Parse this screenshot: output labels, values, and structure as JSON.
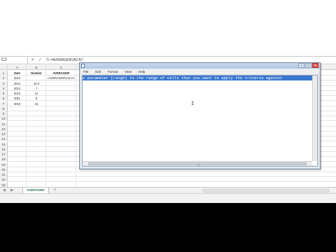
{
  "formula_bar": {
    "name_box": "C2",
    "icons": [
      "x-icon",
      "check-icon",
      "fx-icon"
    ],
    "cancel_symbol": "✕",
    "enter_symbol": "✓",
    "fx_symbol": "fx",
    "formula": "=AVERAGEIF(A2:A7,"
  },
  "sheet": {
    "columns": [
      "A",
      "B",
      "C"
    ],
    "headers": {
      "date": "Date",
      "number": "Number",
      "averageif": "AVERAGEIF"
    },
    "row_numbers": [
      "1",
      "2",
      "3",
      "4",
      "5",
      "6",
      "7",
      "8",
      "9",
      "10",
      "11",
      "12",
      "13",
      "14",
      "15",
      "16",
      "17",
      "18",
      "19",
      "20",
      "21",
      "22",
      "23"
    ],
    "rows": [
      {
        "a": "2012",
        "b": "",
        "c": "=AVERAGEIF(A2:A7,"
      },
      {
        "a": "2012",
        "b": "10.4",
        "c": ""
      },
      {
        "a": "2012",
        "b": "7",
        "c": ""
      },
      {
        "a": "2013",
        "b": "12",
        "c": ""
      },
      {
        "a": "2011",
        "b": "8",
        "c": ""
      },
      {
        "a": "2010",
        "b": "15",
        "c": ""
      }
    ]
  },
  "tabs": {
    "nav_arrows": "◀ ▶",
    "active_sheet": "AVERAGEIF",
    "add_label": "+"
  },
  "notepad": {
    "menu": [
      "File",
      "Edit",
      "Format",
      "View",
      "Help"
    ],
    "controls": {
      "minimize": "–",
      "maximize": "□",
      "close": "✕"
    },
    "selected_text": "e parameter [range] to the range of cells that you want to apply the criteria against",
    "caret": "I",
    "grip": "⁞⁞⁞"
  }
}
